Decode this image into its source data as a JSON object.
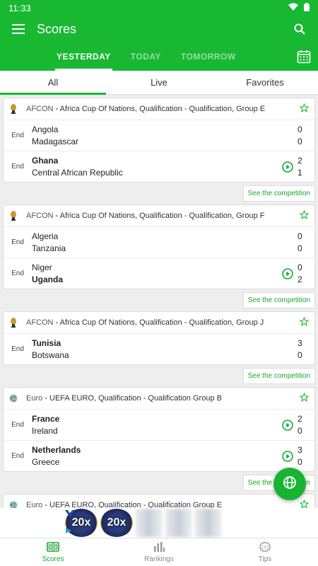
{
  "status_bar": {
    "time": "11:33"
  },
  "app_bar": {
    "title": "Scores"
  },
  "day_tabs": [
    "YESTERDAY",
    "TODAY",
    "TOMORROW"
  ],
  "filter_tabs": [
    "All",
    "Live",
    "Favorites"
  ],
  "see_label": "See the competition",
  "end_label": "End",
  "groups": [
    {
      "abbr": "AFCON",
      "name": "Africa Cup Of Nations, Qualification - Qualification, Group E",
      "matches": [
        {
          "home": "Angola",
          "away": "Madagascar",
          "hs": "0",
          "as": "0"
        },
        {
          "home": "Ghana",
          "away": "Central African Republic",
          "hs": "2",
          "as": "1"
        }
      ]
    },
    {
      "abbr": "AFCON",
      "name": "Africa Cup Of Nations, Qualification - Qualification, Group F",
      "matches": [
        {
          "home": "Algeria",
          "away": "Tanzania",
          "hs": "0",
          "as": "0"
        },
        {
          "home": "Niger",
          "away": "Uganda",
          "hs": "0",
          "as": "2"
        }
      ]
    },
    {
      "abbr": "AFCON",
      "name": "Africa Cup Of Nations, Qualification - Qualification, Group J",
      "matches": [
        {
          "home": "Tunisia",
          "away": "Botswana",
          "hs": "3",
          "as": "0"
        }
      ]
    },
    {
      "abbr": "Euro",
      "name": "UEFA EURO, Qualification - Qualification Group B",
      "matches": [
        {
          "home": "France",
          "away": "Ireland",
          "hs": "2",
          "as": "0"
        },
        {
          "home": "Netherlands",
          "away": "Greece",
          "hs": "3",
          "as": "0"
        }
      ]
    },
    {
      "abbr": "Euro",
      "name": "UEFA EURO, Qualification - Qualification Group E"
    }
  ],
  "ad": {
    "text_1": "20x",
    "text_2": "20x"
  },
  "bottom_nav": [
    "Scores",
    "Rankings",
    "Tips"
  ],
  "colors": {
    "primary": "#18b833",
    "accent_text": "#18a82f"
  }
}
